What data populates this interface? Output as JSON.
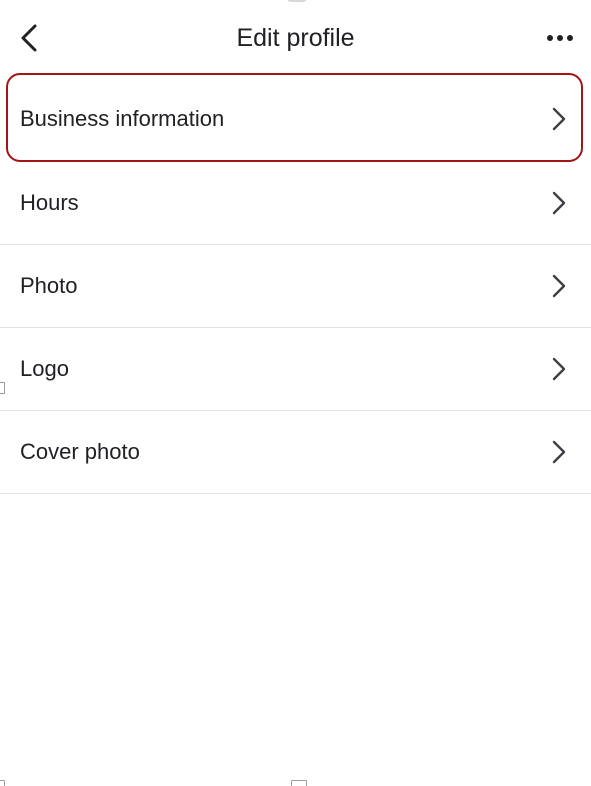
{
  "header": {
    "title": "Edit profile",
    "back_icon": "chevron-left-icon",
    "more_icon": "more-horizontal-icon"
  },
  "menu": {
    "items": [
      {
        "label": "Business information",
        "highlighted": true
      },
      {
        "label": "Hours",
        "highlighted": false
      },
      {
        "label": "Photo",
        "highlighted": false
      },
      {
        "label": "Logo",
        "highlighted": false
      },
      {
        "label": "Cover photo",
        "highlighted": false
      }
    ],
    "item_icon": "chevron-right-icon"
  },
  "colors": {
    "text": "#202124",
    "icon": "#3c4043",
    "divider": "#e3e3e3",
    "highlight": "#a31515",
    "background": "#ffffff"
  }
}
